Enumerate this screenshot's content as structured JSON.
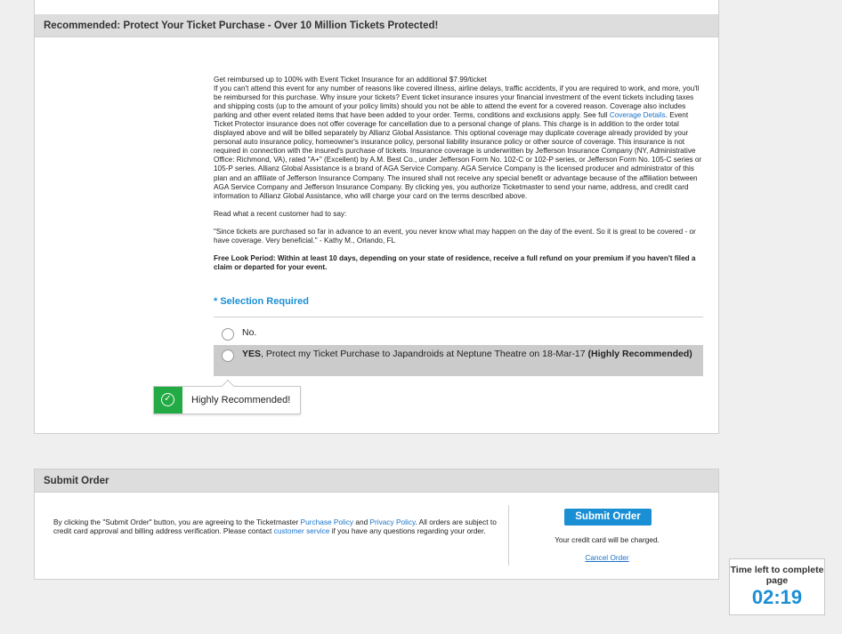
{
  "insurance": {
    "header": "Recommended: Protect Your Ticket Purchase - Over 10 Million Tickets Protected!",
    "p1_lead": "Get reimbursed up to 100% with Event Ticket Insurance for an additional $7.99/ticket",
    "p1_body_a": "If you can't attend this event for any number of reasons like covered illness, airline delays, traffic accidents, if you are required to work, and more, you'll be reimbursed for this purchase. Why insure your tickets? Event ticket insurance insures your financial investment of the event tickets including taxes and shipping costs (up to the amount of your policy limits) should you not be able to attend the event for a covered reason. Coverage also includes parking and other event related items that have been added to your order. Terms, conditions and exclusions apply. See full ",
    "coverage_link": "Coverage Details",
    "p1_body_b": ". Event Ticket Protector insurance does not offer coverage for cancellation due to a personal change of plans. This charge is in addition to the order total displayed above and will be billed separately by Allianz Global Assistance. This optional coverage may duplicate coverage already provided by your personal auto insurance policy, homeowner's insurance policy, personal liability insurance policy or other source of coverage. This insurance is not required in connection with the insured's purchase of tickets. Insurance coverage is underwritten by Jefferson Insurance Company (NY, Administrative Office: Richmond, VA), rated \"A+\" (Excellent) by A.M. Best Co., under Jefferson Form No. 102-C or 102-P series, or Jefferson Form No. 105-C series or 105-P series. Allianz Global Assistance is a brand of AGA Service Company. AGA Service Company is the licensed producer and administrator of this plan and an affiliate of Jefferson Insurance Company. The insured shall not receive any special benefit or advantage because of the affiliation between AGA Service Company and Jefferson Insurance Company. By clicking yes, you authorize Ticketmaster to send your name, address, and credit card information to Allianz Global Assistance, who will charge your card on the terms described above.",
    "p2": "Read what a recent customer had to say:",
    "p3": "\"Since tickets are purchased so far in advance to an event, you never know what may happen on the day of the event. So it is great to be covered - or have coverage. Very beneficial.\" - Kathy M., Orlando, FL",
    "p4": "Free Look Period: Within at least 10 days, depending on your state of residence, receive a full refund on your premium if you haven't filed a claim or departed for your event.",
    "selection_required": "* Selection Required",
    "option_no": "No.",
    "option_yes_bold": "YES",
    "option_yes_text": ", Protect my Ticket Purchase to Japandroids at Neptune Theatre on 18-Mar-17 ",
    "option_yes_tail": "(Highly Recommended)",
    "tooltip": "Highly Recommended!"
  },
  "submit": {
    "header": "Submit Order",
    "text_a": "By clicking the \"Submit Order\" button, you are agreeing to the Ticketmaster ",
    "purchase_policy": "Purchase Policy",
    "and": " and ",
    "privacy_policy": "Privacy Policy",
    "text_b": ". All orders are subject to credit card approval and billing address verification. Please contact ",
    "customer_service": "customer service",
    "text_c": " if you have any questions regarding your order.",
    "button": "Submit Order",
    "charge_note": "Your credit card will be charged.",
    "cancel": "Cancel Order"
  },
  "timer": {
    "label": "Time left to complete page",
    "value": "02:19"
  },
  "colors": {
    "accent": "#1a8fd4",
    "success": "#22aa44",
    "header_bg": "#dddddd",
    "page_bg": "#efefef"
  },
  "icons": {
    "tooltip": "check-circle-icon"
  }
}
